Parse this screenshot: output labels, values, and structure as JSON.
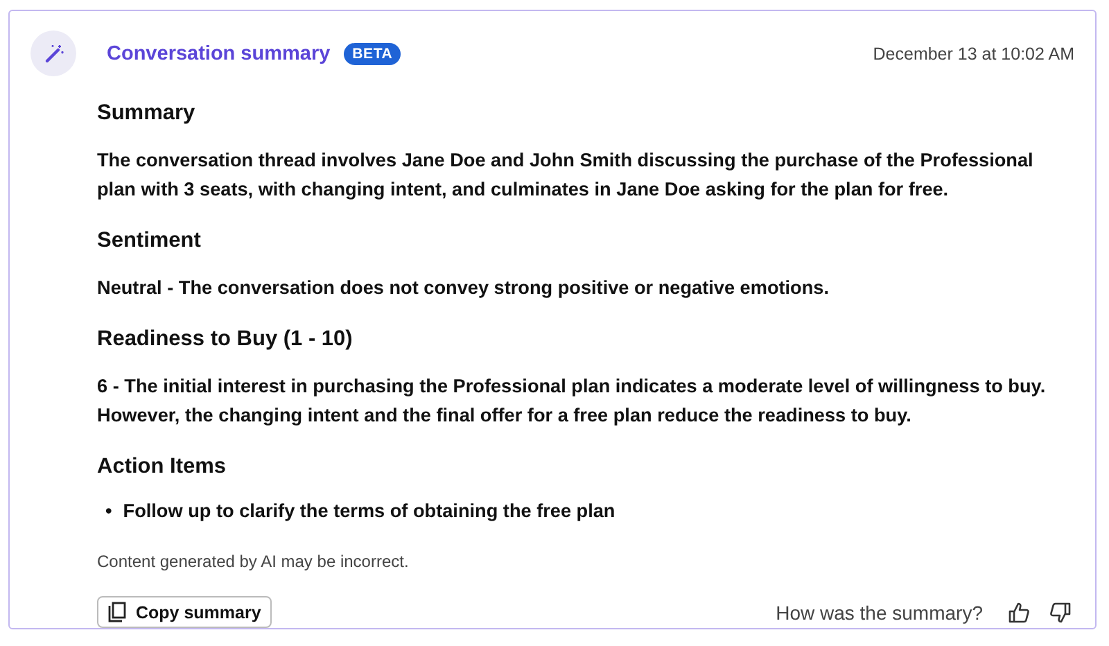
{
  "header": {
    "title": "Conversation summary",
    "badge": "BETA",
    "timestamp": "December 13 at 10:02 AM"
  },
  "sections": [
    {
      "heading": "Summary",
      "kind": "paragraph",
      "text": "The conversation thread involves Jane Doe and John Smith discussing the purchase of the Professional plan with 3 seats, with changing intent, and culminates in Jane Doe asking for the plan for free."
    },
    {
      "heading": "Sentiment",
      "kind": "paragraph",
      "text": "Neutral - The conversation does not convey strong positive or negative emotions."
    },
    {
      "heading": "Readiness to Buy (1 - 10)",
      "kind": "paragraph",
      "text": "6 - The initial interest in purchasing the Professional plan indicates a moderate level of willingness to buy. However, the changing intent and the final offer for a free plan reduce the readiness to buy."
    },
    {
      "heading": "Action Items",
      "kind": "list",
      "items": [
        {
          "marker": "•",
          "text": "Follow up to clarify the terms of obtaining the free plan"
        }
      ]
    }
  ],
  "disclaimer": "Content generated by AI may be incorrect.",
  "footer": {
    "copy_button": "Copy summary",
    "feedback_prompt": "How was the summary?"
  }
}
